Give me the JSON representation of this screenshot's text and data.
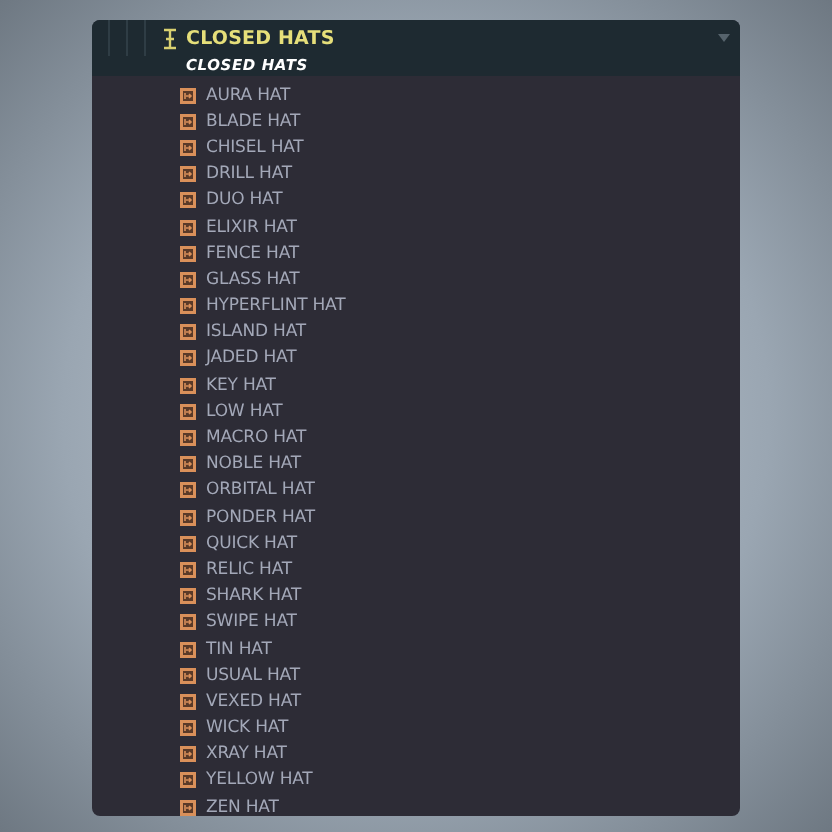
{
  "header": {
    "title": "CLOSED HATS",
    "subtitle": "CLOSED HATS"
  },
  "items": [
    "AURA HAT",
    "BLADE HAT",
    "CHISEL HAT",
    "DRILL HAT",
    "DUO HAT",
    "ELIXIR HAT",
    "FENCE HAT",
    "GLASS HAT",
    "HYPERFLINT HAT",
    "ISLAND HAT",
    "JADED HAT",
    "KEY HAT",
    "LOW HAT",
    "MACRO HAT",
    "NOBLE HAT",
    "ORBITAL HAT",
    "PONDER HAT",
    "QUICK HAT",
    "RELIC HAT",
    "SHARK HAT",
    "SWIPE HAT",
    "TIN HAT",
    "USUAL HAT",
    "VEXED HAT",
    "WICK HAT",
    "XRAY HAT",
    "YELLOW HAT",
    "ZEN HAT"
  ]
}
